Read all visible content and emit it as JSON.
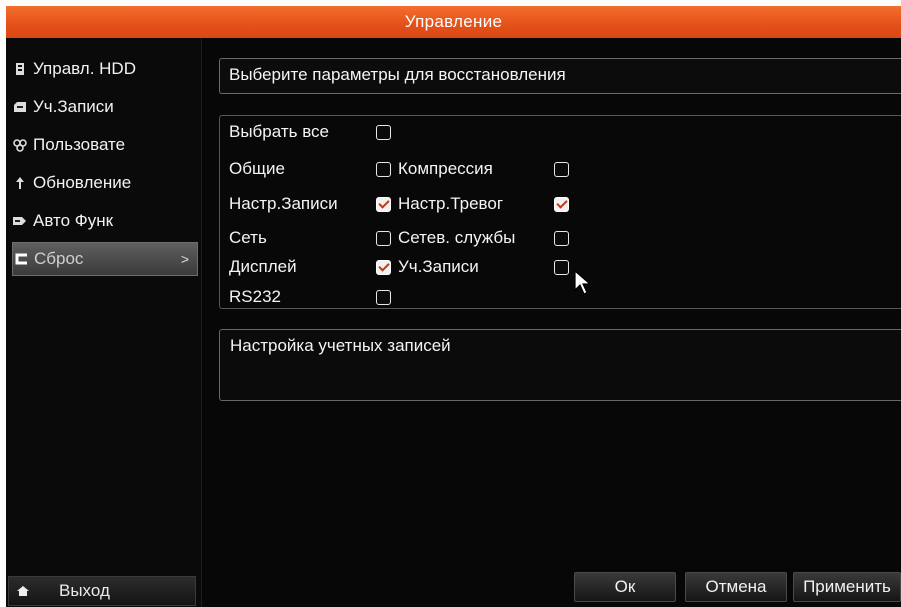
{
  "window": {
    "title": "Управление"
  },
  "sidebar": {
    "items": [
      {
        "label": "Управл. HDD",
        "icon": "hdd-icon"
      },
      {
        "label": "Уч.Записи",
        "icon": "user-account-icon"
      },
      {
        "label": "Пользовате",
        "icon": "users-icon"
      },
      {
        "label": "Обновление",
        "icon": "upgrade-icon"
      },
      {
        "label": "Авто Функ",
        "icon": "auto-function-icon"
      },
      {
        "label": "Сброс",
        "icon": "reset-icon",
        "active": true,
        "chevron": ">"
      }
    ],
    "exit_label": "Выход"
  },
  "main": {
    "header": "Выберите параметры для восстановления",
    "options": {
      "select_all": {
        "label": "Выбрать все",
        "checked": false
      },
      "general": {
        "label": "Общие",
        "checked": false
      },
      "compression": {
        "label": "Компрессия",
        "checked": false
      },
      "record_settings": {
        "label": "Настр.Записи",
        "checked": true
      },
      "alarm_settings": {
        "label": "Настр.Тревог",
        "checked": true
      },
      "network": {
        "label": "Сеть",
        "checked": false
      },
      "network_services": {
        "label": "Сетев. службы",
        "checked": false
      },
      "display": {
        "label": "Дисплей",
        "checked": true
      },
      "accounts": {
        "label": "Уч.Записи",
        "checked": false
      },
      "rs232": {
        "label": "RS232",
        "checked": false
      }
    },
    "description": "Настройка учетных записей"
  },
  "footer": {
    "ok_label": "Ок",
    "cancel_label": "Отмена",
    "apply_label": "Применить"
  },
  "colors": {
    "title_bar": "#e4501a",
    "background": "#070707",
    "check_mark": "#c03b1a"
  }
}
